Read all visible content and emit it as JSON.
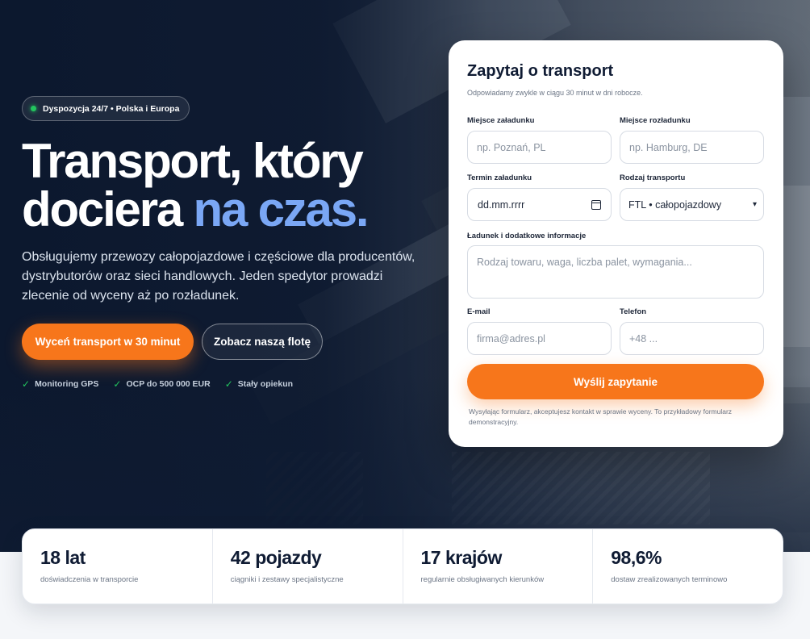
{
  "hero": {
    "badge": "Dyspozycja 24/7 • Polska i Europa",
    "headline_line1": "Transport, który",
    "headline_line2_start": "dociera ",
    "headline_accent": "na czas.",
    "lead": "Obsługujemy przewozy całopojazdowe i częściowe dla producentów, dystrybutorów oraz sieci handlowych. Jeden spedytor prowadzi zlecenie od wyceny aż po rozładunek.",
    "primary_button": "Wyceń transport w 30 minut",
    "secondary_button": "Zobacz naszą flotę",
    "features": [
      "Monitoring GPS",
      "OCP do 500 000 EUR",
      "Stały opiekun"
    ]
  },
  "form": {
    "title": "Zapytaj o transport",
    "subtitle": "Odpowiadamy zwykle w ciągu 30 minut w dni robocze.",
    "loading_place_label": "Miejsce załadunku",
    "loading_place_placeholder": "np. Poznań, PL",
    "unloading_place_label": "Miejsce rozładunku",
    "unloading_place_placeholder": "np. Hamburg, DE",
    "loading_date_label": "Termin załadunku",
    "loading_date_value": "dd.mm.rrrr",
    "transport_type_label": "Rodzaj transportu",
    "transport_type_value": "FTL • całopojazdowy",
    "cargo_label": "Ładunek i dodatkowe informacje",
    "cargo_placeholder": "Rodzaj towaru, waga, liczba palet, wymagania...",
    "email_label": "E-mail",
    "email_placeholder": "firma@adres.pl",
    "phone_label": "Telefon",
    "phone_placeholder": "+48 ...",
    "submit": "Wyślij zapytanie",
    "disclaimer": "Wysyłając formularz, akceptujesz kontakt w sprawie wyceny. To przykładowy formularz demonstracyjny."
  },
  "stats": [
    {
      "value": "18 lat",
      "label": "doświadczenia w transporcie"
    },
    {
      "value": "42 pojazdy",
      "label": "ciągniki i zestawy specjalistyczne"
    },
    {
      "value": "17 krajów",
      "label": "regularnie obsługiwanych kierunków"
    },
    {
      "value": "98,6%",
      "label": "dostaw zrealizowanych terminowo"
    }
  ],
  "colors": {
    "accent_orange": "#f7761b",
    "accent_blue": "#7aa7f5",
    "hero_dark": "#0f1c33",
    "status_green": "#22c55e"
  }
}
